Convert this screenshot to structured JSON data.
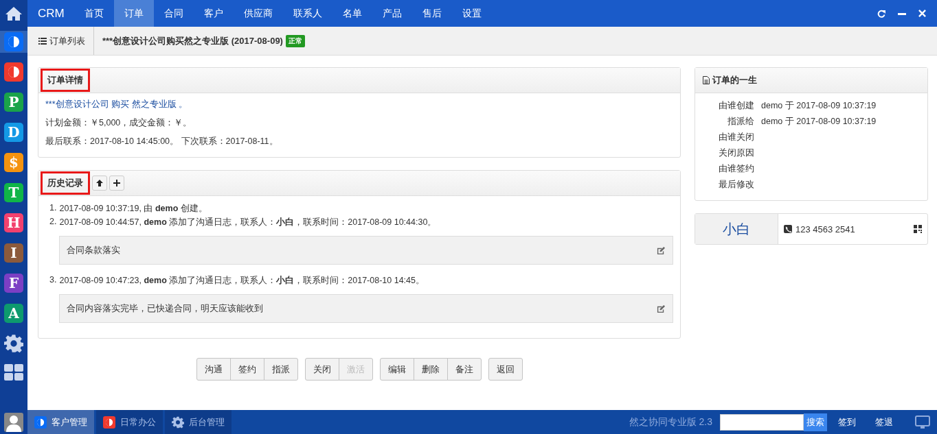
{
  "top_nav": {
    "brand": "CRM",
    "items": [
      {
        "label": "首页",
        "selected": false
      },
      {
        "label": "订单",
        "selected": true
      },
      {
        "label": "合同",
        "selected": false
      },
      {
        "label": "客户",
        "selected": false
      },
      {
        "label": "供应商",
        "selected": false
      },
      {
        "label": "联系人",
        "selected": false
      },
      {
        "label": "名单",
        "selected": false
      },
      {
        "label": "产品",
        "selected": false
      },
      {
        "label": "售后",
        "selected": false
      },
      {
        "label": "设置",
        "selected": false
      }
    ]
  },
  "sidebar": {
    "apps": [
      {
        "kind": "half",
        "color": "#0a6cf5",
        "selected": true
      },
      {
        "kind": "half",
        "color": "#f03a2e",
        "selected": false
      },
      {
        "kind": "letter",
        "glyph": "P",
        "color": "#1aa34a",
        "selected": false
      },
      {
        "kind": "letter",
        "glyph": "D",
        "color": "#1499e6",
        "selected": false
      },
      {
        "kind": "letter",
        "glyph": "$",
        "color": "#f5930f",
        "selected": false
      },
      {
        "kind": "letter",
        "glyph": "T",
        "color": "#10b548",
        "selected": false
      },
      {
        "kind": "letter",
        "glyph": "H",
        "color": "#f2416e",
        "selected": false
      },
      {
        "kind": "letter",
        "glyph": "I",
        "color": "#8c5a3c",
        "selected": false
      },
      {
        "kind": "letter",
        "glyph": "F",
        "color": "#7b3fc4",
        "selected": false
      },
      {
        "kind": "letter",
        "glyph": "A",
        "color": "#0d9a6e",
        "selected": false
      },
      {
        "kind": "gear",
        "selected": false
      },
      {
        "kind": "grid",
        "selected": false
      }
    ]
  },
  "breadcrumb": {
    "list_link": "订单列表",
    "title": "***创意设计公司购买然之专业版 (2017-08-09)",
    "status": "正常"
  },
  "order_detail": {
    "heading": "订单详情",
    "highlighted": true,
    "summary": "***创意设计公司 购买 然之专业版 。",
    "amounts": "计划金额：￥5,000，成交金额：￥。",
    "contacts": "最后联系：2017-08-10 14:45:00。 下次联系：2017-08-11。"
  },
  "history": {
    "heading": "历史记录",
    "highlighted": true,
    "entries": [
      {
        "number": "1.",
        "text": "2017-08-09 10:37:19, 由 **demo** 创建。"
      },
      {
        "number": "2.",
        "text": "2017-08-09 10:44:57, **demo** 添加了沟通日志，联系人：**小白**，联系时间：2017-08-09 10:44:30。",
        "comment": "合同条款落实"
      },
      {
        "number": "3.",
        "text": "2017-08-09 10:47:23, **demo** 添加了沟通日志，联系人：**小白**，联系时间：2017-08-10 14:45。",
        "comment": "合同内容落实完毕，已快递合同，明天应该能收到"
      }
    ]
  },
  "actions": [
    [
      {
        "label": "沟通",
        "disabled": false
      },
      {
        "label": "签约",
        "disabled": false
      },
      {
        "label": "指派",
        "disabled": false
      }
    ],
    [
      {
        "label": "关闭",
        "disabled": false
      },
      {
        "label": "激活",
        "disabled": true
      }
    ],
    [
      {
        "label": "编辑",
        "disabled": false
      },
      {
        "label": "删除",
        "disabled": false
      },
      {
        "label": "备注",
        "disabled": false
      }
    ],
    [
      {
        "label": "返回",
        "disabled": false
      }
    ]
  ],
  "lifecycle": {
    "heading": "订单的一生",
    "fields": [
      {
        "label": "由谁创建",
        "value": "demo 于 2017-08-09 10:37:19"
      },
      {
        "label": "指派给",
        "value": "demo 于 2017-08-09 10:37:19"
      },
      {
        "label": "由谁关闭"
      },
      {
        "label": "关闭原因"
      },
      {
        "label": "由谁签约"
      },
      {
        "label": "最后修改"
      }
    ]
  },
  "contact": {
    "name": "小白",
    "phone": "123 4563 2541"
  },
  "taskbar": {
    "apps": [
      {
        "kind": "half",
        "color": "#0a6cf5",
        "label": "客户管理",
        "selected": true
      },
      {
        "kind": "half",
        "color": "#f03a2e",
        "label": "日常办公",
        "selected": false
      },
      {
        "kind": "gear",
        "label": "后台管理",
        "selected": false
      }
    ],
    "version": "然之协同专业版 2.3",
    "search_button": "搜索",
    "links": [
      "签到",
      "签退"
    ]
  }
}
